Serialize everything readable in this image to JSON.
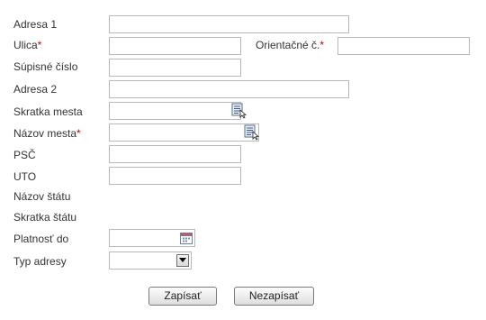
{
  "form": {
    "labels": {
      "adresa1": "Adresa 1",
      "ulica": "Ulica",
      "orientacne": "Orientačné č.",
      "supisne": "Súpisné číslo",
      "adresa2": "Adresa 2",
      "skratka_mesta": "Skratka mesta",
      "nazov_mesta": "Názov mesta",
      "psc": "PSČ",
      "uto": "UTO",
      "nazov_statu": "Názov štátu",
      "skratka_statu": "Skratka štátu",
      "platnost_do": "Platnosť do",
      "typ_adresy": "Typ adresy"
    },
    "required_marker": "*",
    "values": {
      "adresa1": "",
      "ulica": "",
      "orientacne": "",
      "supisne": "",
      "adresa2": "",
      "skratka_mesta": "",
      "nazov_mesta": "",
      "psc": "",
      "uto": "",
      "platnost_do": "",
      "typ_adresy": ""
    },
    "icons": {
      "list_picker": "list-picker-icon",
      "calendar": "calendar-icon",
      "dropdown": "chevron-down-icon"
    },
    "colors": {
      "required": "#cc0000",
      "label": "#333333",
      "input_border": "#b8b8b8"
    }
  },
  "buttons": {
    "save_label": "Zapísať",
    "cancel_label": "Nezapísať"
  }
}
